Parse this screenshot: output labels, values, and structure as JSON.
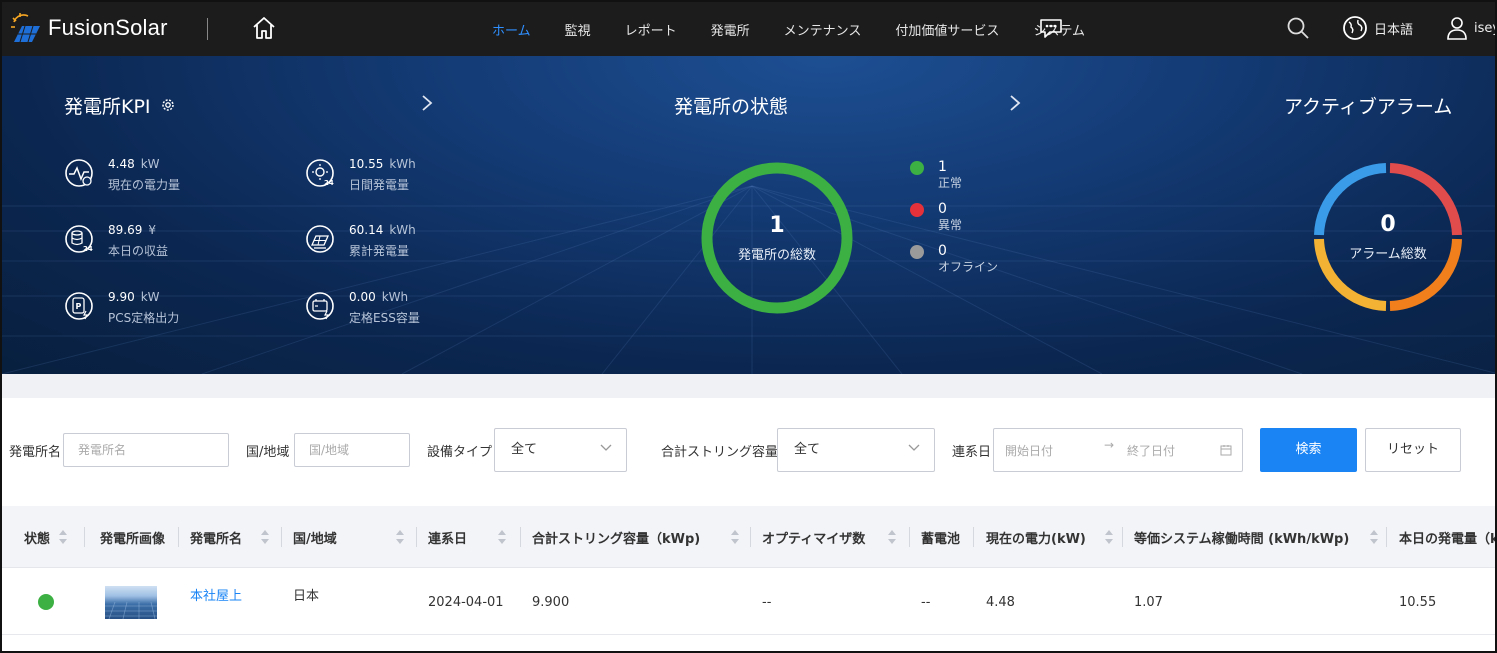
{
  "header": {
    "logo_text": "FusionSolar",
    "nav": [
      {
        "label": "ホーム",
        "active": true
      },
      {
        "label": "監視",
        "active": false
      },
      {
        "label": "レポート",
        "active": false
      },
      {
        "label": "発電所",
        "active": false
      },
      {
        "label": "メンテナンス",
        "active": false
      },
      {
        "label": "付加価値サービス",
        "active": false
      },
      {
        "label": "システム",
        "active": false
      }
    ],
    "language": "日本語",
    "user": "isey"
  },
  "kpi": {
    "title": "発電所KPI",
    "items": [
      {
        "value": "4.48",
        "unit": "kW",
        "label": "現在の電力量",
        "icon": "power-pulse-icon"
      },
      {
        "value": "10.55",
        "unit": "kWh",
        "label": "日間発電量",
        "icon": "sun-24-icon"
      },
      {
        "value": "89.69",
        "unit": "¥",
        "label": "本日の収益",
        "icon": "revenue-24-icon"
      },
      {
        "value": "60.14",
        "unit": "kWh",
        "label": "累計発電量",
        "icon": "solar-panel-icon"
      },
      {
        "value": "9.90",
        "unit": "kW",
        "label": "PCS定格出力",
        "icon": "inverter-icon"
      },
      {
        "value": "0.00",
        "unit": "kWh",
        "label": "定格ESS容量",
        "icon": "battery-icon"
      }
    ]
  },
  "plant_status": {
    "title": "発電所の状態",
    "total": "1",
    "total_label": "発電所の総数",
    "legend": [
      {
        "count": "1",
        "label": "正常",
        "color": "#3cb043"
      },
      {
        "count": "0",
        "label": "異常",
        "color": "#e5323a"
      },
      {
        "count": "0",
        "label": "オフライン",
        "color": "#9a9a9a"
      }
    ]
  },
  "alarms": {
    "title": "アクティブアラーム",
    "total": "0",
    "total_label": "アラーム総数",
    "colors": [
      "#e04c4c",
      "#f07f1c",
      "#f3b234",
      "#3a9be8"
    ]
  },
  "filter": {
    "plant_name_label": "発電所名",
    "plant_name_placeholder": "発電所名",
    "region_label": "国/地域",
    "region_placeholder": "国/地域",
    "device_type_label": "設備タイプ",
    "device_type_value": "全て",
    "string_capacity_label": "合計ストリング容量",
    "string_capacity_value": "全て",
    "grid_date_label": "連系日",
    "start_placeholder": "開始日付",
    "end_placeholder": "終了日付",
    "search_button": "検索",
    "reset_button": "リセット"
  },
  "table": {
    "columns": [
      "状態",
      "発電所画像",
      "発電所名",
      "国/地域",
      "連系日",
      "合計ストリング容量（kWp)",
      "オプティマイザ数",
      "蓄電池",
      "現在の電力(kW)",
      "等価システム稼働時間 (kWh/kWp)",
      "本日の発電量（kWh)"
    ],
    "rows": [
      {
        "status": "normal",
        "name": "本社屋上",
        "region": "日本",
        "grid_date": "2024-04-01",
        "string_capacity": "9.900",
        "optimizers": "--",
        "battery": "--",
        "current_power": "4.48",
        "equiv_hours": "1.07",
        "today_energy": "10.55"
      }
    ]
  }
}
